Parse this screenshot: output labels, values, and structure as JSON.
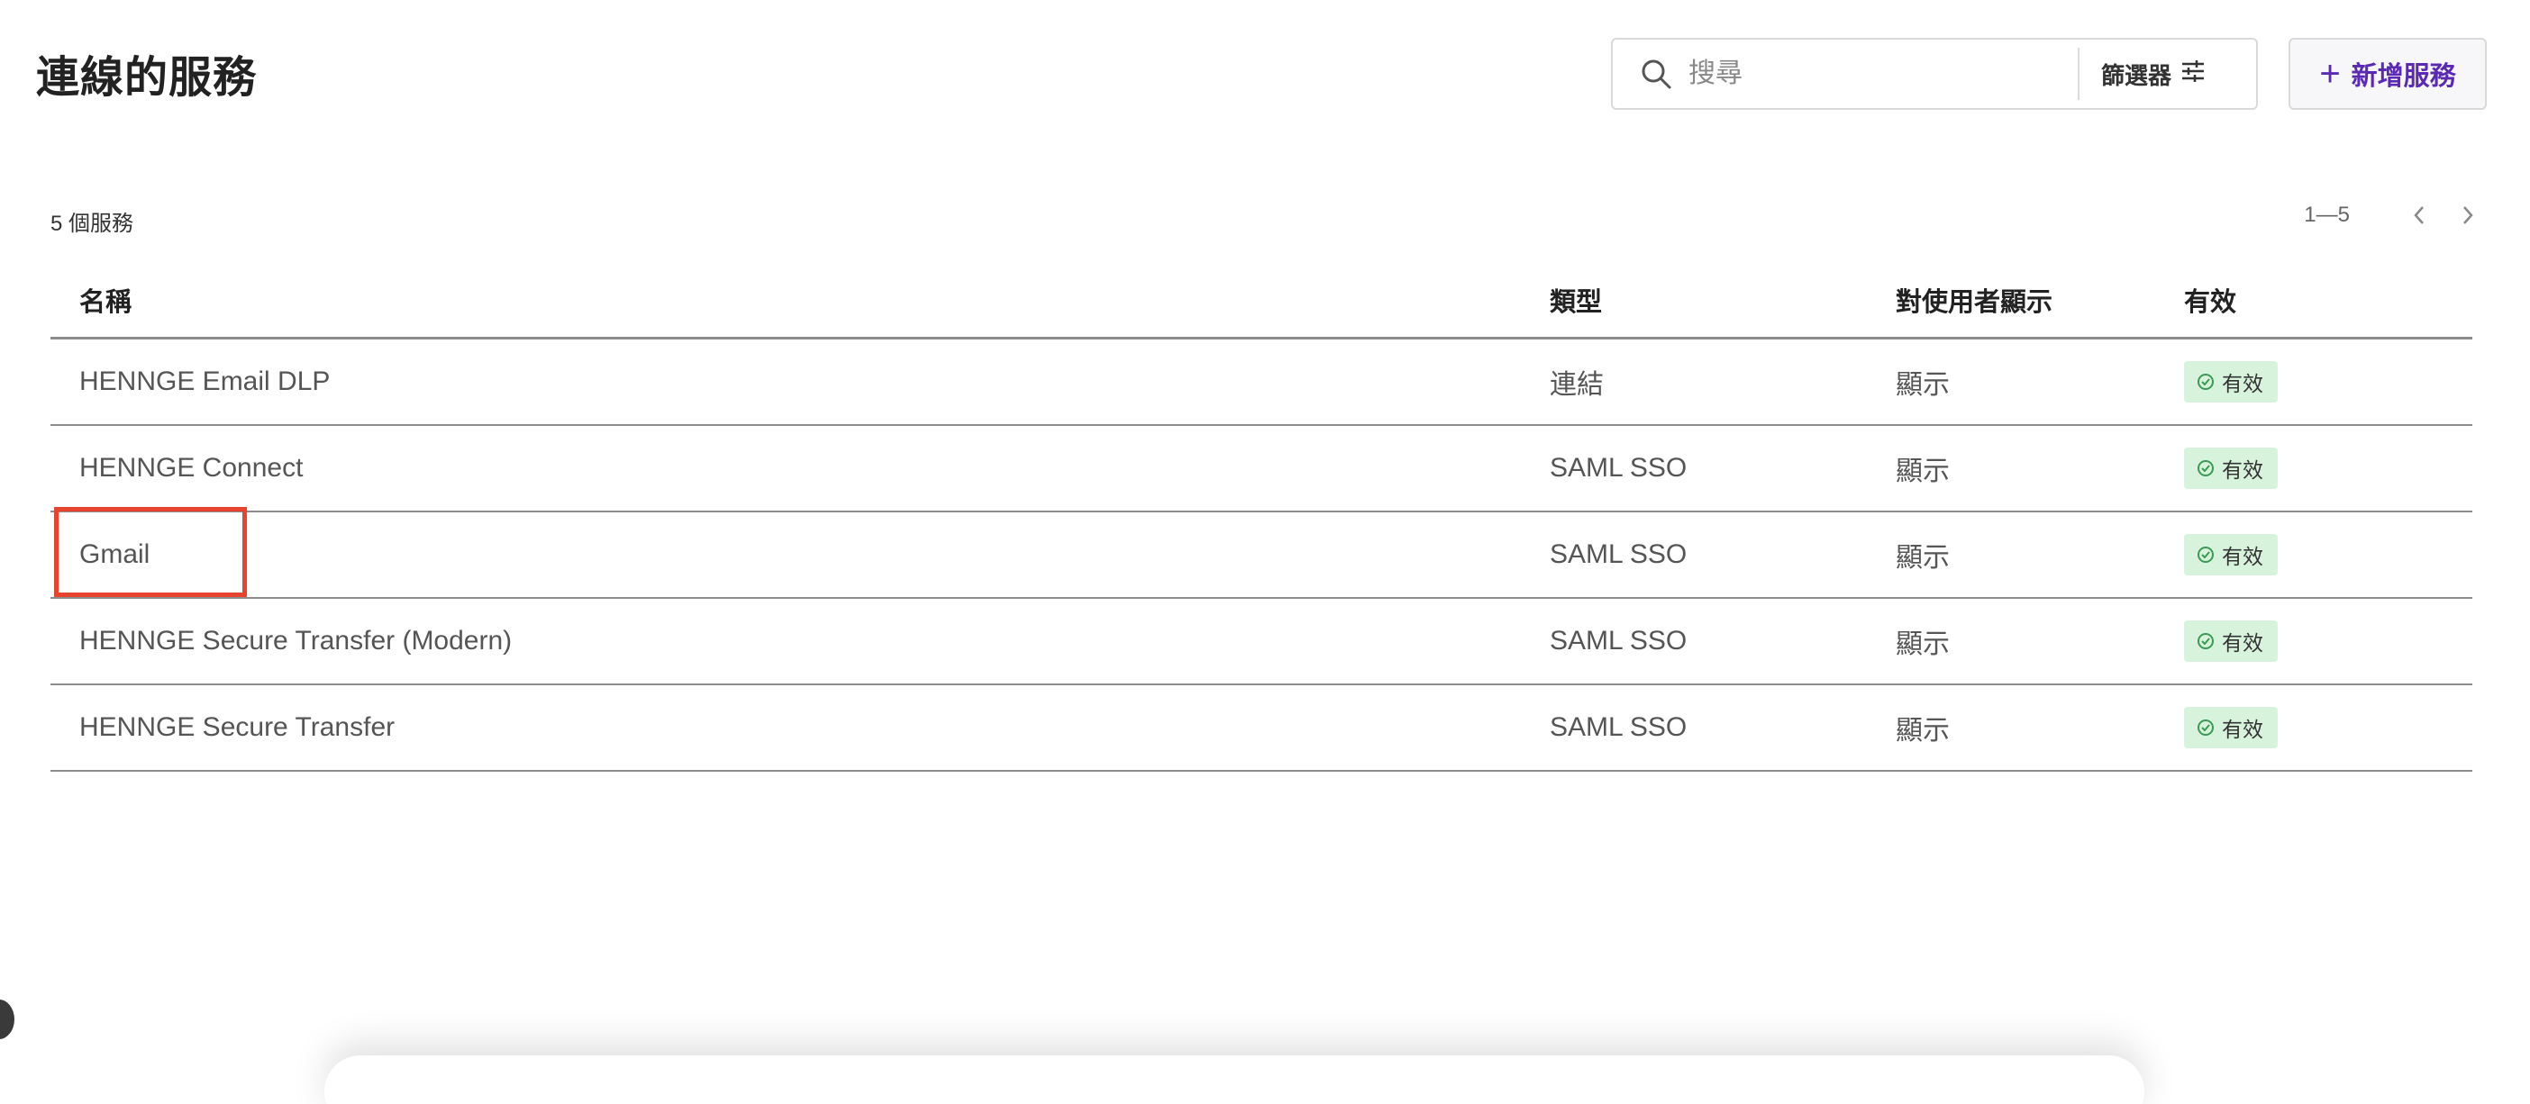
{
  "header": {
    "title": "連線的服務",
    "search_placeholder": "搜尋",
    "filter_label": "篩選器",
    "add_button_label": "新增服務"
  },
  "summary": {
    "count_text": "5 個服務",
    "pagination_range": "1—5"
  },
  "table": {
    "columns": [
      "名稱",
      "類型",
      "對使用者顯示",
      "有效"
    ],
    "rows": [
      {
        "name": "HENNGE Email DLP",
        "type": "連結",
        "visibility": "顯示",
        "status": "有效"
      },
      {
        "name": "HENNGE Connect",
        "type": "SAML SSO",
        "visibility": "顯示",
        "status": "有效"
      },
      {
        "name": "Gmail",
        "type": "SAML SSO",
        "visibility": "顯示",
        "status": "有效"
      },
      {
        "name": "HENNGE Secure Transfer (Modern)",
        "type": "SAML SSO",
        "visibility": "顯示",
        "status": "有效"
      },
      {
        "name": "HENNGE Secure Transfer",
        "type": "SAML SSO",
        "visibility": "顯示",
        "status": "有效"
      }
    ]
  },
  "icons": {
    "search": "search-icon",
    "filter": "sliders-icon",
    "add": "plus-icon",
    "prev": "chevron-left-icon",
    "next": "chevron-right-icon",
    "status": "check-circle-icon"
  },
  "colors": {
    "accent": "#5b2ab5",
    "status_badge_bg": "#d7f3dc",
    "status_icon": "#3b9b54",
    "highlight": "#e8432e"
  }
}
